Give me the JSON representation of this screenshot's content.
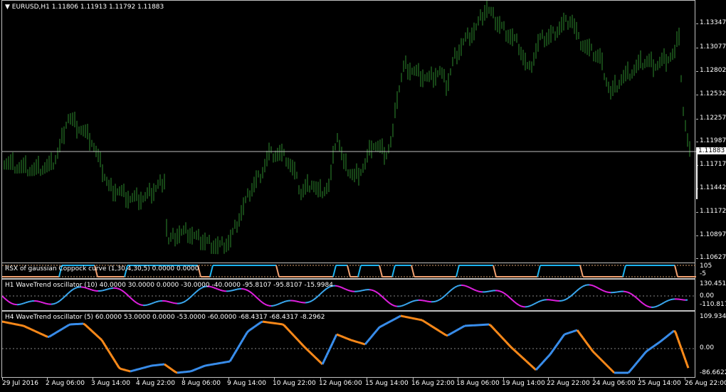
{
  "main": {
    "symbol_label": "EURUSD,H1",
    "ohlc": "1.11806 1.11913 1.11792 1.11883",
    "current_price": "1.11883",
    "y_ticks": [
      "1.13347",
      "1.13077",
      "1.12802",
      "1.12532",
      "1.12257",
      "1.11987",
      "1.11717",
      "1.11442",
      "1.11172",
      "1.10897",
      "1.10627"
    ],
    "colors": {
      "bars": "#2e8b2e",
      "price_line": "#c0c0c0"
    }
  },
  "rsx": {
    "title": "RSX of gaussian Coppock curve (1,30,4,30,5) 0.0000 0.0000",
    "scale_top": "105",
    "scale_bottom": "-5",
    "colors": {
      "up": "#1eb4f0",
      "down": "#f0a070",
      "level": "#d8a070"
    }
  },
  "wt1": {
    "title": "H1 WaveTrend oscillator (10) 40.0000 30.0000 0.0000 -30.0000 -40.0000 -95.8107 -95.8107 -15.9984",
    "y_ticks": [
      "130.451",
      "0.00",
      "-110.8175"
    ],
    "colors": {
      "up": "#3aa8f0",
      "down": "#e020e0"
    }
  },
  "wt4": {
    "title": "H4 WaveTrend oscillator (5) 60.0000 53.0000 0.0000 -53.0000 -60.0000 -68.4317 -68.4317 -8.2962",
    "y_ticks": [
      "109.9344",
      "0.00",
      "-86.6622"
    ],
    "colors": {
      "up": "#3a90f0",
      "down": "#ff8c1a"
    }
  },
  "x_axis": {
    "labels": [
      "29 Jul 2016",
      "2 Aug 06:00",
      "3 Aug 14:00",
      "4 Aug 22:00",
      "8 Aug 06:00",
      "9 Aug 14:00",
      "10 Aug 22:00",
      "12 Aug 06:00",
      "15 Aug 14:00",
      "16 Aug 22:00",
      "18 Aug 06:00",
      "19 Aug 14:00",
      "22 Aug 22:00",
      "24 Aug 06:00",
      "25 Aug 14:00",
      "26 Aug 22:00"
    ]
  }
}
